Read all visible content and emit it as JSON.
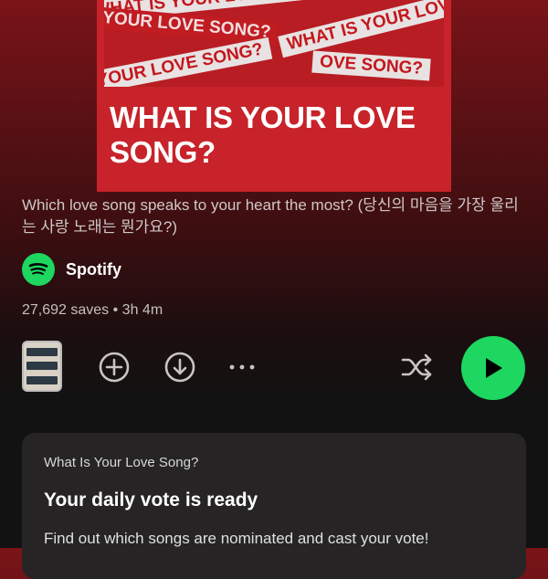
{
  "cover": {
    "tapes": [
      "WHAT IS YOUR LOVE SONG?",
      "YOUR LOVE SONG?",
      "WHAT IS YOUR LOVE",
      "OVE SONG?",
      "IS YOUR LOVE SONG?"
    ],
    "title": "WHAT IS YOUR LOVE SONG?"
  },
  "playlist": {
    "description": "Which love song speaks to your heart the most? (당신의 마음을 가장 울리는 사랑 노래는 뭔가요?)",
    "owner": "Spotify",
    "meta": "27,692 saves • 3h 4m"
  },
  "controls": {
    "icons": [
      "playlist-thumbnail",
      "add-icon",
      "download-icon",
      "more-icon",
      "shuffle-icon",
      "play-icon"
    ]
  },
  "card": {
    "eyebrow": "What Is Your Love Song?",
    "title": "Your daily vote is ready",
    "body": "Find out which songs are nominated and cast your vote!"
  },
  "colors": {
    "accent_green": "#1ed760",
    "cover_red": "#c8232a",
    "background": "#121212"
  }
}
